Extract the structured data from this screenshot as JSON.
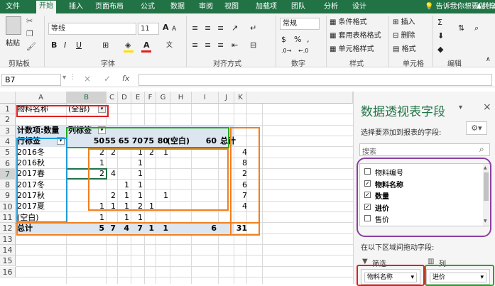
{
  "tabs": [
    "文件",
    "开始",
    "插入",
    "页面布局",
    "公式",
    "数据",
    "审阅",
    "视图",
    "加载项",
    "团队",
    "分析",
    "设计"
  ],
  "tell_me": "告诉我你想要做什么",
  "user_share": "共享",
  "ribbon": {
    "paste": "粘贴",
    "clipboard": "剪贴板",
    "font_name": "等线",
    "font_size": "11",
    "font_group": "字体",
    "align_group": "对齐方式",
    "number_format": "常规",
    "number_group": "数字",
    "cond_format": "条件格式",
    "table_format": "套用表格格式",
    "cell_style": "单元格样式",
    "style_group": "样式",
    "insert": "插入",
    "delete": "删除",
    "format": "格式",
    "cells_group": "单元格",
    "editing_group": "编辑",
    "bold": "B",
    "italic": "I",
    "underline": "U",
    "percent": "%",
    "comma": ","
  },
  "formula_bar": {
    "name_box": "B7",
    "fx": "fx",
    "cancel": "×",
    "enter": "✓",
    "value": ""
  },
  "columns": [
    "A",
    "B",
    "C",
    "D",
    "E",
    "F",
    "G",
    "H",
    "I",
    "J",
    "K",
    "L"
  ],
  "rows": [
    "1",
    "2",
    "3",
    "4",
    "5",
    "6",
    "7",
    "8",
    "9",
    "10",
    "11",
    "12",
    "13",
    "14",
    "15",
    "16"
  ],
  "pivot": {
    "filter_label": "物料名称",
    "filter_value": "(全部)",
    "count_label": "计数项:数量",
    "col_label": "列标签",
    "row_label": "行标签",
    "col_values": [
      "50",
      "55",
      "65",
      "70",
      "75",
      "80",
      "(空白)",
      "60"
    ],
    "total_label": "总计",
    "row_items": [
      "2016冬",
      "2016秋",
      "2017春",
      "2017冬",
      "2017秋",
      "2017夏",
      "(空白)"
    ],
    "cells": [
      [
        "1",
        "",
        "",
        "1",
        "",
        "",
        "",
        ""
      ],
      [
        "2",
        "4",
        "",
        "1",
        "",
        "",
        "",
        ""
      ],
      [
        "",
        "",
        "1",
        "1",
        "",
        "",
        "",
        ""
      ],
      [
        "",
        "2",
        "1",
        "1",
        "",
        "1",
        "",
        ""
      ],
      [
        "1",
        "1",
        "1",
        "2",
        "1",
        "",
        "",
        ""
      ],
      [
        "1",
        "",
        "1",
        "1",
        "",
        "",
        "",
        ""
      ],
      [
        "",
        "",
        "",
        "",
        "",
        "",
        "",
        ""
      ]
    ],
    "row_totals": [
      "4",
      "8",
      "2",
      "6",
      "7",
      "4",
      ""
    ],
    "grand_label": "总计",
    "grand_row": [
      "5",
      "7",
      "4",
      "7",
      "1",
      "1",
      "",
      "6"
    ],
    "grand_total": "31",
    "header_totals": [
      "2",
      "2",
      "",
      "1",
      "2",
      "1",
      "",
      ""
    ]
  },
  "pane": {
    "title": "数据透视表字段",
    "subtitle": "选择要添加到报表的字段:",
    "search_placeholder": "搜索",
    "fields": [
      {
        "label": "物料编号",
        "checked": false
      },
      {
        "label": "物料名称",
        "checked": true
      },
      {
        "label": "数量",
        "checked": true
      },
      {
        "label": "进价",
        "checked": true
      },
      {
        "label": "售价",
        "checked": false
      }
    ],
    "drag_hint": "在以下区域间拖动字段:",
    "filter_area": "筛选",
    "column_area": "列",
    "filter_field": "物料名称",
    "column_field": "进价"
  },
  "colors": {
    "excel_green": "#217346",
    "red": "#e02020",
    "green": "#22aa22",
    "orange": "#f08020",
    "blue": "#1e9bd7",
    "purple": "#8b3fa0"
  }
}
